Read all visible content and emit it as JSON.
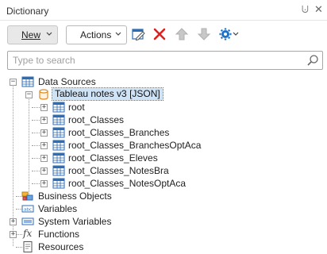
{
  "panel": {
    "title": "Dictionary",
    "pin_glyph": "⨃",
    "close_glyph": "✕"
  },
  "toolbar": {
    "new_label": "New",
    "actions_label": "Actions",
    "icons": [
      "edit-icon",
      "delete-icon",
      "move-up-icon",
      "move-down-icon",
      "settings-icon"
    ]
  },
  "search": {
    "placeholder": "Type to search",
    "value": ""
  },
  "tree": {
    "data_sources": {
      "label": "Data Sources",
      "source": {
        "label": "Tableau notes v3 [JSON]",
        "tables": [
          "root",
          "root_Classes",
          "root_Classes_Branches",
          "root_Classes_BranchesOptAca",
          "root_Classes_Eleves",
          "root_Classes_NotesBra",
          "root_Classes_NotesOptAca"
        ]
      }
    },
    "business_objects": "Business Objects",
    "variables": "Variables",
    "system_variables": "System Variables",
    "functions": "Functions",
    "resources": "Resources"
  },
  "colors": {
    "accent": "#1e73c6",
    "delete": "#e02020",
    "selection": "#cfe3f7"
  }
}
